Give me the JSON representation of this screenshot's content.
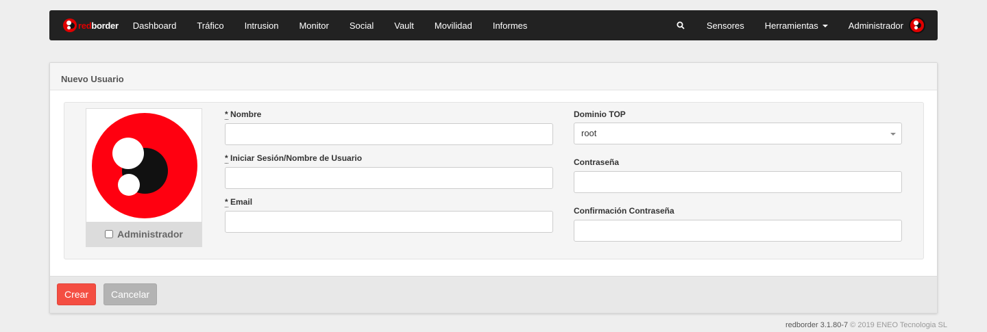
{
  "navbar": {
    "brand_red": "red",
    "brand_white": "border",
    "items": [
      {
        "label": "Dashboard"
      },
      {
        "label": "Tráfico"
      },
      {
        "label": "Intrusion"
      },
      {
        "label": "Monitor"
      },
      {
        "label": "Social"
      },
      {
        "label": "Vault"
      },
      {
        "label": "Movilidad"
      },
      {
        "label": "Informes"
      }
    ],
    "sensores": "Sensores",
    "herramientas": "Herramientas",
    "user": "Administrador"
  },
  "panel": {
    "title": "Nuevo Usuario",
    "admin_label": "Administrador",
    "fields": {
      "nombre": {
        "req": "*",
        "label": " Nombre",
        "value": ""
      },
      "login": {
        "req": "*",
        "label": " Iniciar Sesión/Nombre de Usuario",
        "value": ""
      },
      "email": {
        "req": "*",
        "label": " Email",
        "value": ""
      },
      "dominio": {
        "label": "Dominio TOP",
        "value": "root"
      },
      "password": {
        "label": "Contraseña",
        "value": ""
      },
      "password_confirm": {
        "label": "Confirmación Contraseña",
        "value": ""
      }
    },
    "buttons": {
      "create": "Crear",
      "cancel": "Cancelar"
    }
  },
  "footer": {
    "version": "redborder 3.1.80-7",
    "copyright": "© 2019 ENEO Tecnologia SL"
  },
  "colors": {
    "navbar_bg": "#222222",
    "brand_red": "#e00000",
    "create_btn": "#f44e42",
    "cancel_btn": "#b3b3b3"
  }
}
